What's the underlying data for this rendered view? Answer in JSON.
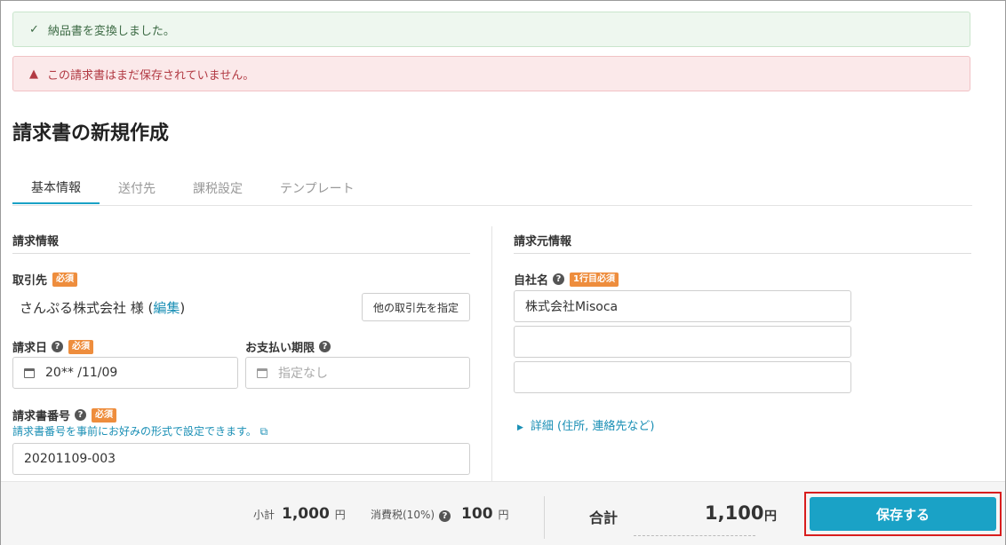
{
  "alerts": {
    "success": {
      "icon": "✓",
      "text": "納品書を変換しました。"
    },
    "danger": {
      "icon": "▲",
      "text": "この請求書はまだ保存されていません。"
    }
  },
  "page_title": "請求書の新規作成",
  "tabs": [
    {
      "label": "基本情報",
      "active": true
    },
    {
      "label": "送付先"
    },
    {
      "label": "課税設定"
    },
    {
      "label": "テンプレート"
    }
  ],
  "left": {
    "section_title": "請求情報",
    "client_label": "取引先",
    "required": "必須",
    "client_name": "さんぷる株式会社 様 (",
    "client_edit": "編集",
    "client_close": ")",
    "other_client_button": "他の取引先を指定",
    "invoice_date_label": "請求日",
    "invoice_date_value": "20** /11/09",
    "due_label": "お支払い期限",
    "due_placeholder": "指定なし",
    "number_label": "請求書番号",
    "number_hint": "請求書番号を事前にお好みの形式で設定できます。 ⧉",
    "number_value": "20201109-003"
  },
  "right": {
    "section_title": "請求元情報",
    "company_label": "自社名",
    "company_badge": "1行目必須",
    "company_line1": "株式会社Misoca",
    "company_line2": "",
    "company_line3": "",
    "detail_link": "詳細 (住所, 連絡先など)"
  },
  "footer": {
    "subtotal_label": "小計",
    "subtotal_value": "1,000",
    "tax_label": "消費税(10%)",
    "tax_value": "100",
    "yen": "円",
    "total_label": "合計",
    "total_value": "1,100",
    "save_button": "保存する"
  },
  "colors": {
    "accent": "#1aa2c6",
    "badge": "#ee8d3d",
    "highlight": "#d81d1d"
  }
}
